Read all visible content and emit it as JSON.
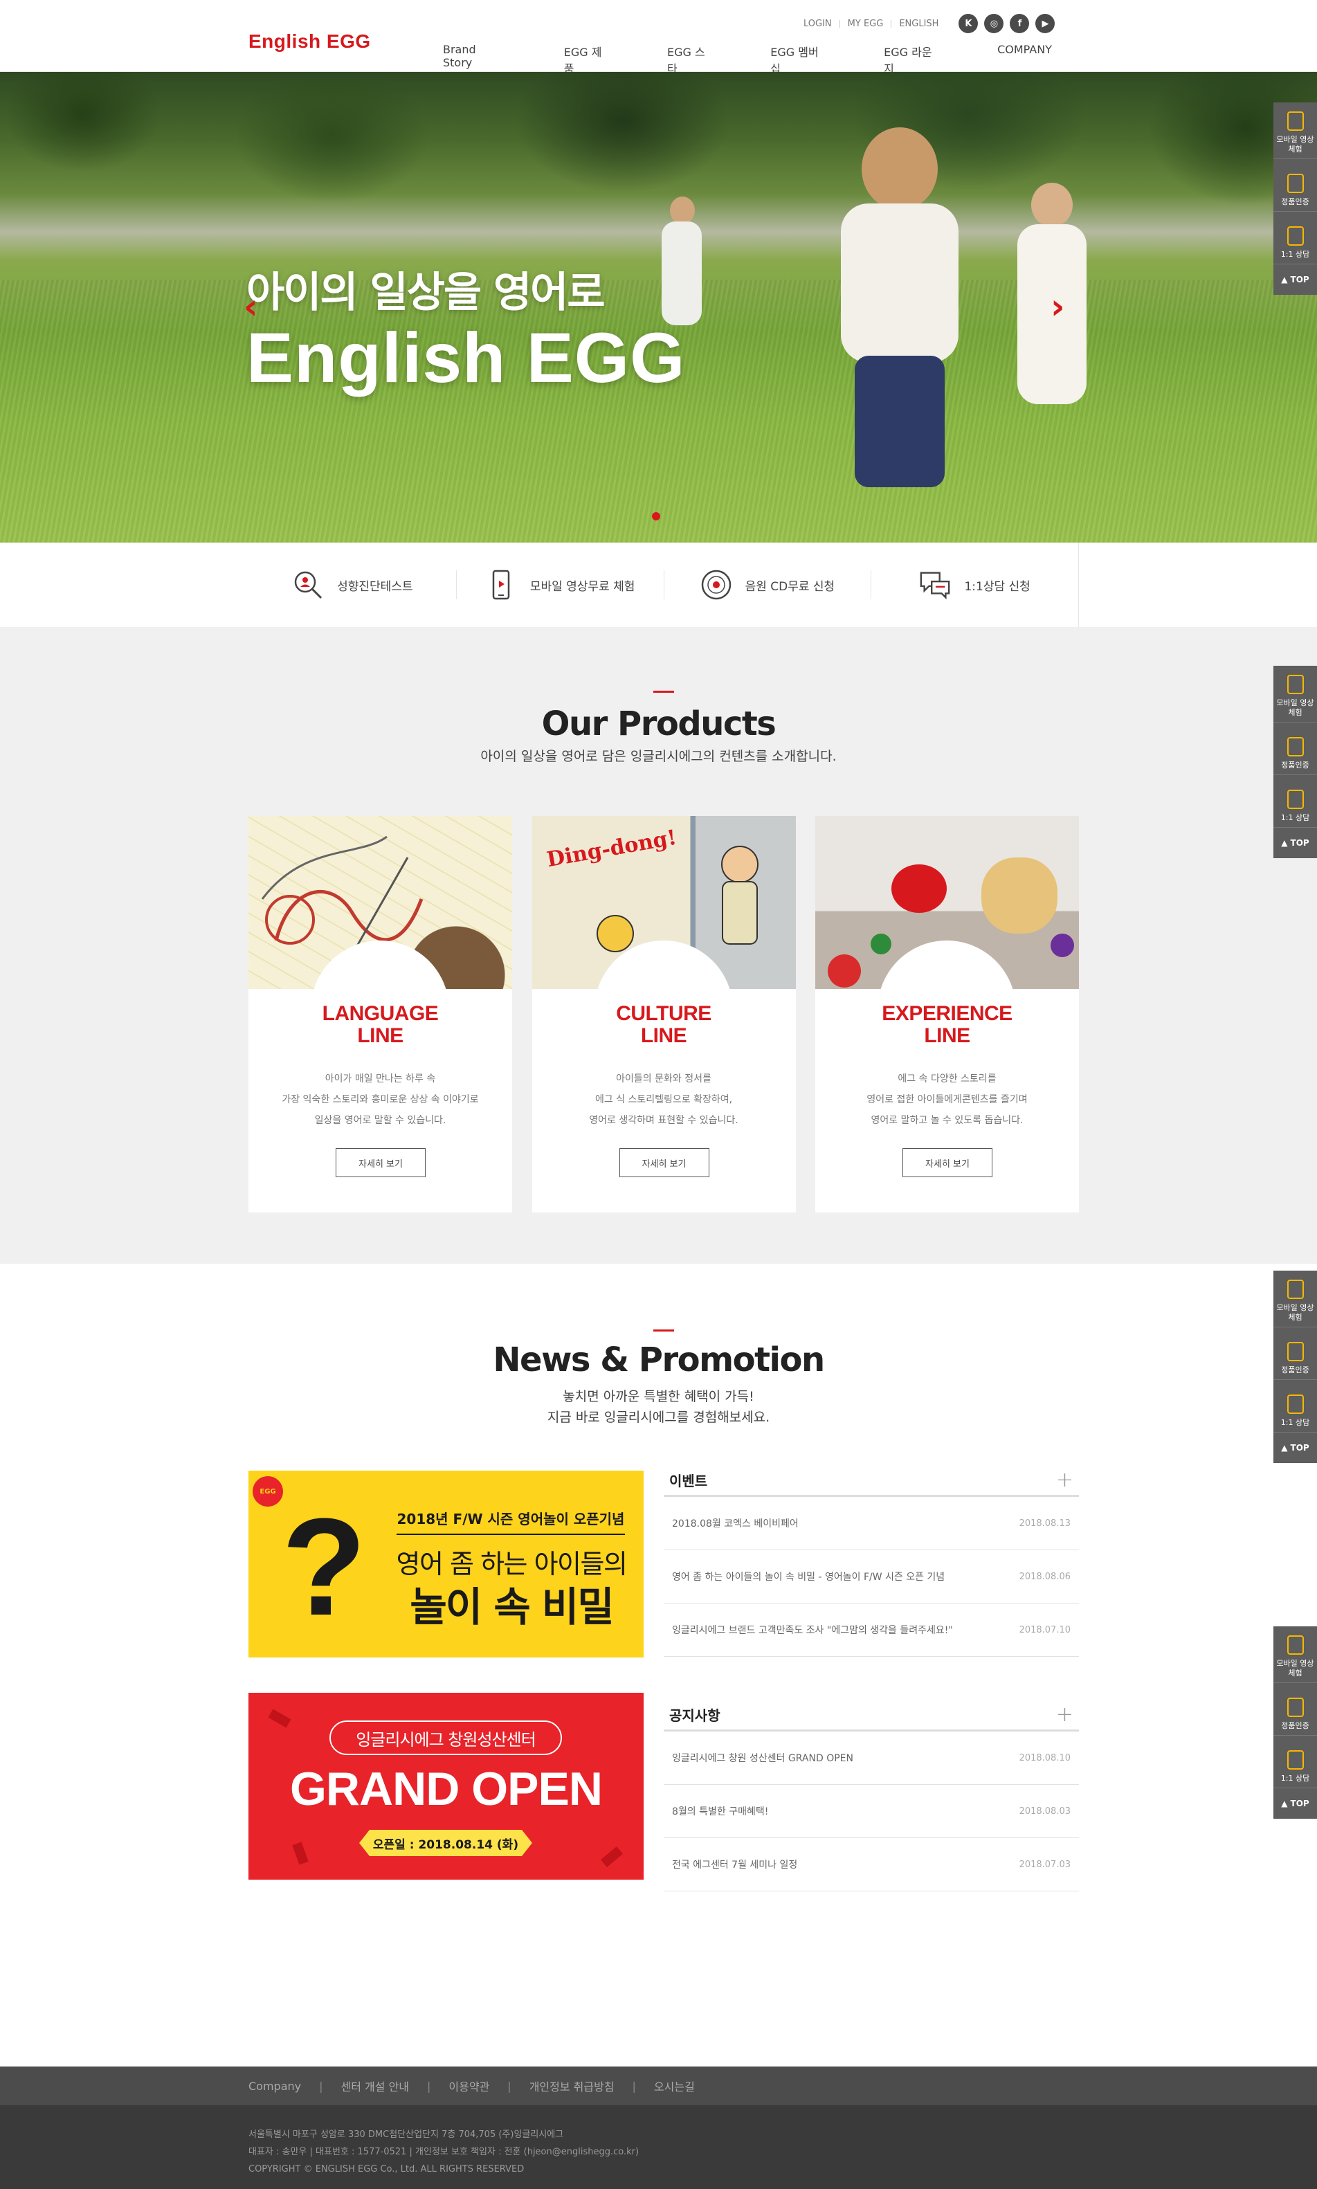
{
  "header": {
    "logo": "English EGG",
    "util": [
      "LOGIN",
      "MY EGG",
      "ENGLISH"
    ],
    "social": [
      {
        "icon": "kakao-story-icon",
        "glyph": "K"
      },
      {
        "icon": "instagram-icon",
        "glyph": "◎"
      },
      {
        "icon": "facebook-icon",
        "glyph": "f"
      },
      {
        "icon": "youtube-icon",
        "glyph": "▶"
      }
    ],
    "nav": [
      "Brand Story",
      "EGG 제품",
      "EGG 스타",
      "EGG 멤버십",
      "EGG 라운지",
      "COMPANY"
    ]
  },
  "hero": {
    "subtitle": "아이의 일상을 영어로",
    "title": "English EGG",
    "prev": "‹",
    "next": "›",
    "active_slide": 1,
    "slide_count": 1
  },
  "quick": [
    {
      "label": "성향진단테스트",
      "icon": "search-person-icon"
    },
    {
      "label": "모바일 영상무료 체험",
      "icon": "mobile-icon"
    },
    {
      "label": "음원 CD무료 신청",
      "icon": "cd-icon"
    },
    {
      "label": "1:1상담 신청",
      "icon": "chat-icon"
    }
  ],
  "products": {
    "title": "Our Products",
    "desc": "아이의 일상을 영어로 담은 잉글리시에그의 컨텐츠를 소개합니다.",
    "cards": [
      {
        "line1": "LANGUAGE",
        "line2": "LINE",
        "desc": [
          "아이가 매일 만나는 하루 속",
          "가장 익숙한 스토리와 흥미로운 상상 속 이야기로",
          "일상을 영어로 말할 수 있습니다."
        ],
        "more": "자세히 보기"
      },
      {
        "line1": "CULTURE",
        "line2": "LINE",
        "desc": [
          "아이들의 문화와 정서를",
          "에그 식 스토리텔링으로 확장하여,",
          "영어로 생각하며 표현할 수 있습니다."
        ],
        "more": "자세히 보기",
        "scribble": "Ding-dong!"
      },
      {
        "line1": "EXPERIENCE",
        "line2": "LINE",
        "desc": [
          "에그 속 다양한 스토리를",
          "영어로 접한 아이들에게콘텐츠를 즐기며",
          "영어로 말하고 놀 수 있도록 돕습니다."
        ],
        "more": "자세히 보기"
      }
    ]
  },
  "news": {
    "title": "News & Promotion",
    "desc1": "놓치면 아까운 특별한 혜택이 가득!",
    "desc2": "지금 바로 잉글리시에그를 경험해보세요.",
    "banner1": {
      "badge": "EGG",
      "mark": "?",
      "line1": "2018년 F/W 시즌 영어놀이 오픈기념",
      "line2": "영어 좀 하는 아이들의",
      "line3": "놀이 속 비밀"
    },
    "banner2": {
      "pill": "잉글리시에그 창원성산센터",
      "big": "GRAND OPEN",
      "date": "오픈일 : 2018.08.14 (화)"
    },
    "boards": [
      {
        "title": "이벤트",
        "plus": "+",
        "rows": [
          {
            "text": "2018.08월 코엑스 베이비페어",
            "date": "2018.08.13"
          },
          {
            "text": "영어 좀 하는 아이들의 놀이 속 비밀 - 영어놀이 F/W 시즌 오픈 기념",
            "date": "2018.08.06"
          },
          {
            "text": "잉글리시에그 브랜드 고객만족도 조사 \"에그맘의 생각을 들려주세요!\"",
            "date": "2018.07.10"
          }
        ]
      },
      {
        "title": "공지사항",
        "plus": "+",
        "rows": [
          {
            "text": "잉글리시에그 창원 성산센터 GRAND OPEN",
            "date": "2018.08.10"
          },
          {
            "text": "8월의 특별한 구매혜택!",
            "date": "2018.08.03"
          },
          {
            "text": "전국 에그센터 7월 세미나 일정",
            "date": "2018.07.03"
          }
        ]
      }
    ]
  },
  "footer": {
    "nav": [
      "Company",
      "센터 개설 안내",
      "이용약관",
      "개인정보 취급방침",
      "오시는길"
    ],
    "sep": "|",
    "info": [
      "서울특별시 마포구 성암로 330 DMC첨단산업단지 7층 704,705 (주)잉글리시에그",
      "대표자 : 송만우    |    대표번호 : 1577-0521    |    개인정보 보호 책임자 : 전훈 (hjeon@englishegg.co.kr)",
      "COPYRIGHT © ENGLISH EGG Co., Ltd. ALL RIGHTS RESERVED"
    ]
  },
  "sidebar": {
    "items": [
      "모바일 영상 체험",
      "정품인증",
      "1:1 상담"
    ],
    "top": "TOP"
  },
  "colors": {
    "brand": "#d7191d",
    "banner_yellow": "#fdd31c",
    "banner_red": "#e8232a",
    "footer": "#4c4c4c"
  }
}
